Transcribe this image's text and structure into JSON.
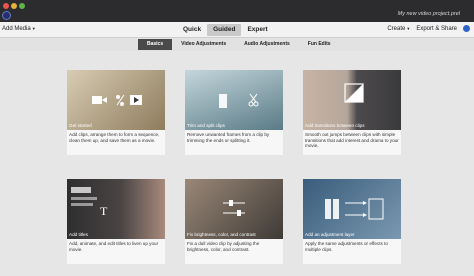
{
  "window": {
    "project_name": "My new video project.prel"
  },
  "toolbar": {
    "add_media": "Add Media",
    "modes": [
      "Quick",
      "Guided",
      "Expert"
    ],
    "active_mode": "Guided",
    "create": "Create",
    "export": "Export & Share"
  },
  "subtabs": {
    "items": [
      "Basics",
      "Video Adjustments",
      "Audio Adjustments",
      "Fun Edits"
    ],
    "active": "Basics"
  },
  "cards": [
    {
      "title": "Get started",
      "desc": "Add clips, arrange them to form a sequence, clean them up, and save them as a movie.",
      "icon": "video-audio-icon",
      "colors": [
        "#d7ccb4",
        "#a08e6f"
      ]
    },
    {
      "title": "Trim and split clips",
      "desc": "Remove unwanted frames from a clip by trimming the ends or splitting it.",
      "icon": "scissors-icon",
      "colors": [
        "#b6cad0",
        "#5a7b86"
      ]
    },
    {
      "title": "Add transitions between clips",
      "desc": "Smooth out jumps between clips with simple transitions that add interest and drama to your movie.",
      "icon": "transition-icon",
      "colors": [
        "#b5a69c",
        "#4d4a4c"
      ]
    },
    {
      "title": "Add titles",
      "desc": "Add, animate, and edit titles to liven up your movie.",
      "icon": "titles-icon",
      "colors": [
        "#3a3a3a",
        "#806860"
      ]
    },
    {
      "title": "Fix brightness, color, and contrast",
      "desc": "Fix a dull video clip by adjusting the brightness, color, and contrast.",
      "icon": "sliders-icon",
      "colors": [
        "#8a786a",
        "#3f3a36"
      ]
    },
    {
      "title": "Add an adjustment layer",
      "desc": "Apply the same adjustments or effects to multiple clips.",
      "icon": "adjustment-layer-icon",
      "colors": [
        "#2d4d6a",
        "#6b8aa4"
      ]
    }
  ]
}
